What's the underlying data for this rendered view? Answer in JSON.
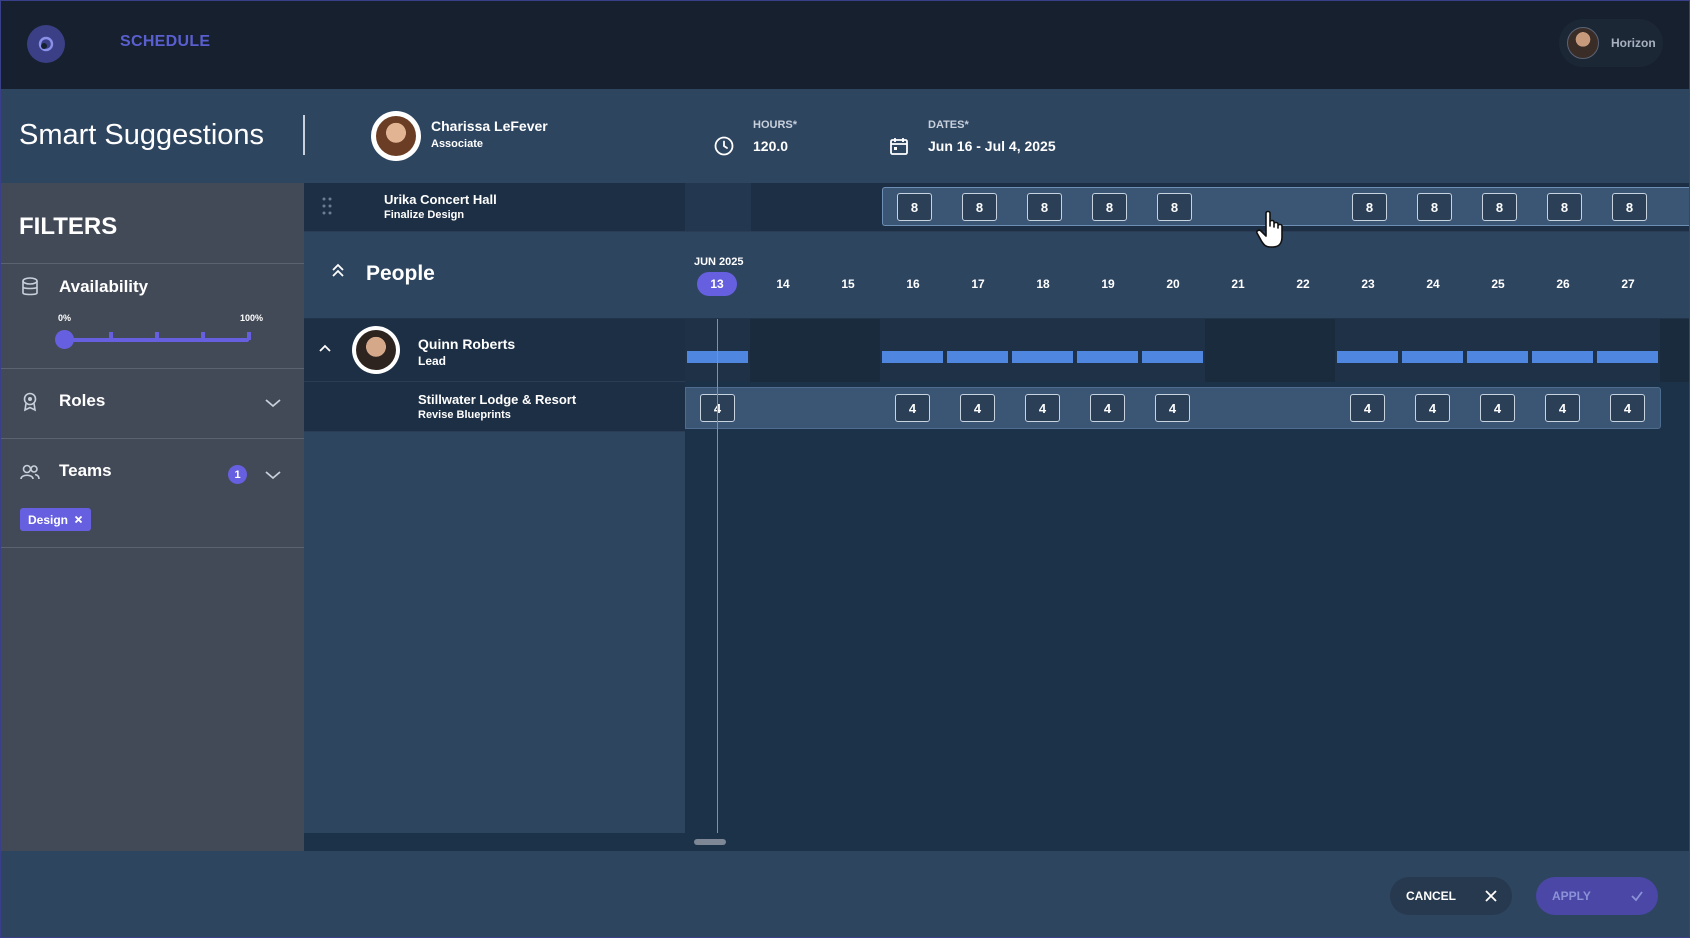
{
  "topbar": {
    "nav_label": "SCHEDULE",
    "user_name": "Horizon"
  },
  "header": {
    "title": "Smart Suggestions",
    "person_name": "Charissa LeFever",
    "person_role": "Associate",
    "hours_label": "HOURS*",
    "hours_value": "120.0",
    "dates_label": "DATES*",
    "dates_value": "Jun 16 - Jul 4, 2025"
  },
  "filters": {
    "title": "FILTERS",
    "availability_label": "Availability",
    "slider_min_label": "0%",
    "slider_max_label": "100%",
    "slider_value": 0,
    "roles_label": "Roles",
    "teams_label": "Teams",
    "teams_count": "1",
    "team_chip": "Design"
  },
  "project": {
    "name": "Urika Concert Hall",
    "task": "Finalize Design",
    "hours": [
      "8",
      "8",
      "8",
      "8",
      "8",
      "8",
      "8",
      "8",
      "8",
      "8"
    ]
  },
  "people": {
    "title": "People",
    "month_label": "JUN 2025",
    "days": [
      "13",
      "14",
      "15",
      "16",
      "17",
      "18",
      "19",
      "20",
      "21",
      "22",
      "23",
      "24",
      "25",
      "26",
      "27"
    ],
    "today": "13",
    "person": {
      "name": "Quinn Roberts",
      "role": "Lead"
    },
    "assignment": {
      "name": "Stillwater Lodge & Resort",
      "task": "Revise Blueprints",
      "hours": [
        "4",
        "4",
        "4",
        "4",
        "4",
        "4",
        "4",
        "4",
        "4",
        "4",
        "4"
      ]
    }
  },
  "footer": {
    "cancel_label": "CANCEL",
    "apply_label": "APPLY"
  },
  "colors": {
    "accent": "#6660e0",
    "allocation": "#4e86e0",
    "topbar": "#16202e",
    "panel": "#2e4560"
  }
}
